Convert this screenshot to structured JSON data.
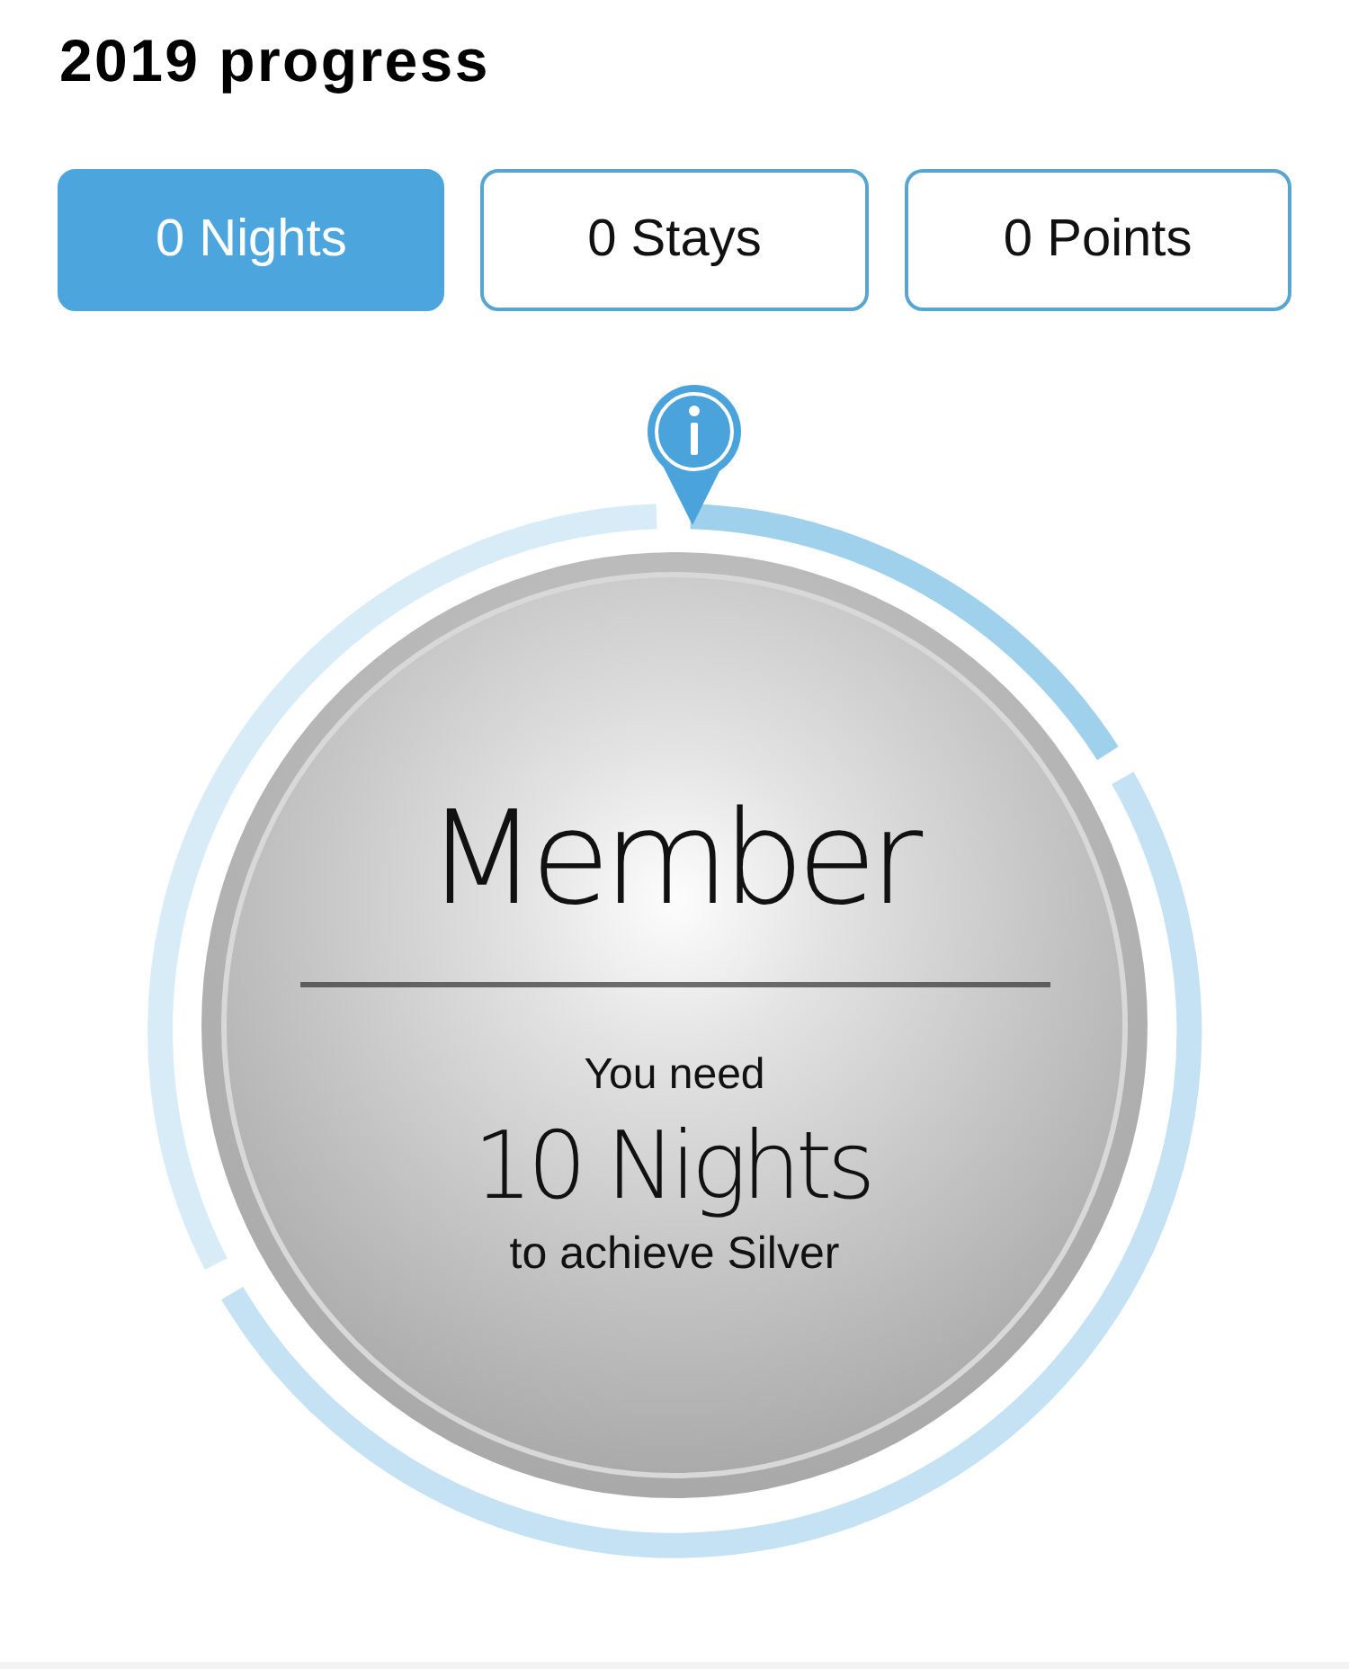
{
  "title": "2019 progress",
  "tabs": [
    {
      "label": "0 Nights",
      "selected": true
    },
    {
      "label": "0 Stays",
      "selected": false
    },
    {
      "label": "0 Points",
      "selected": false
    }
  ],
  "ring": {
    "segments": [
      {
        "color": "#9fd0ec"
      },
      {
        "color": "#c4e2f4"
      },
      {
        "color": "#d8ecf8"
      }
    ]
  },
  "medal": {
    "tier": "Member",
    "need_label": "You need",
    "need_value": "10 Nights",
    "goal_label": "to achieve Silver"
  }
}
